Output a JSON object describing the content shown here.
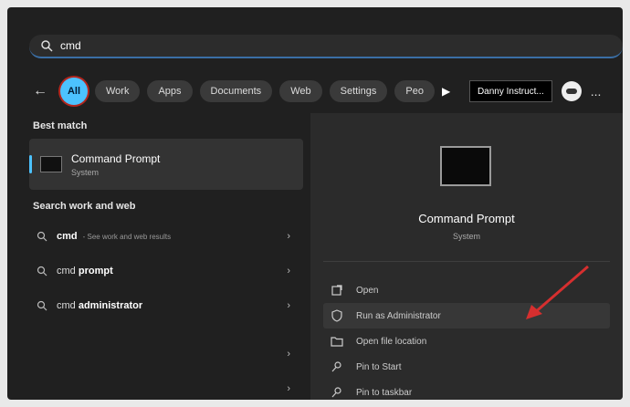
{
  "search": {
    "query": "cmd"
  },
  "filters": {
    "active": "All",
    "items": [
      "Work",
      "Apps",
      "Documents",
      "Web",
      "Settings",
      "Peo"
    ],
    "account": "Danny Instruct...",
    "more": "..."
  },
  "left": {
    "best_match_title": "Best match",
    "best_match": {
      "title": "Command Prompt",
      "subtitle": "System"
    },
    "search_section_title": "Search work and web",
    "results": [
      {
        "prefix": "cmd",
        "bold": "",
        "hint": "- See work and web results"
      },
      {
        "prefix": "cmd ",
        "bold": "prompt",
        "hint": ""
      },
      {
        "prefix": "cmd ",
        "bold": "administrator",
        "hint": ""
      }
    ]
  },
  "preview": {
    "title": "Command Prompt",
    "subtitle": "System",
    "actions": [
      "Open",
      "Run as Administrator",
      "Open file location",
      "Pin to Start",
      "Pin to taskbar"
    ]
  },
  "colors": {
    "accent": "#4cc2ff",
    "panel": "#202020",
    "arrow": "#d62f2f"
  }
}
